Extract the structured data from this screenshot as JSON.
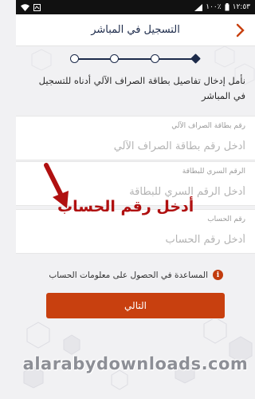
{
  "status_bar": {
    "time": "١٢:٥٣",
    "battery": "١٠٠٪"
  },
  "header": {
    "title": "التسجيل في المباشر",
    "back_icon": "chevron-right-icon"
  },
  "stepper": {
    "steps": 4,
    "current_step": 1
  },
  "intro_text": "نأمل إدخال تفاصيل بطاقة الصراف الآلي أدناه للتسجيل في المباشر",
  "fields": [
    {
      "label": "رقم بطاقة الصراف الآلي",
      "placeholder": "أدخل رقم بطاقة الصراف الآلي",
      "value": ""
    },
    {
      "label": "الرقم السري للبطاقة",
      "placeholder": "أدخل الرقم السري للبطاقة",
      "value": ""
    },
    {
      "label": "رقم الحساب",
      "placeholder": "أدخل رقم الحساب",
      "value": ""
    }
  ],
  "help_link": "المساعدة في الحصول على معلومات الحساب",
  "next_button": "التالي",
  "annotation_text": "أدخل رقم الحساب",
  "watermark": "alarabydownloads.com",
  "colors": {
    "primary_navy": "#1c2a4a",
    "accent_orange": "#c8400f",
    "annotation_red": "#b01010",
    "background": "#f1f1f3"
  }
}
